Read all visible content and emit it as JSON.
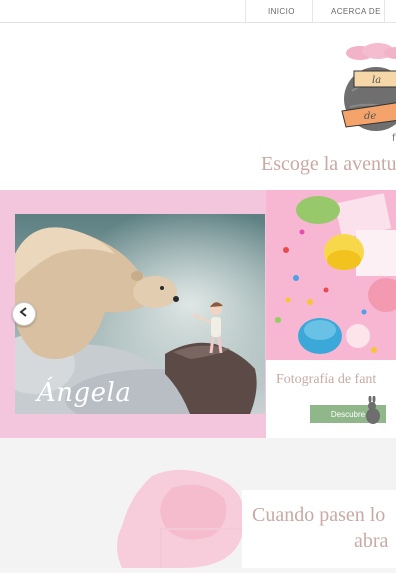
{
  "nav": {
    "items": [
      {
        "label": "INICIO"
      },
      {
        "label": "ACERCA DE"
      }
    ]
  },
  "header": {
    "headline": "Escoge la aventu"
  },
  "slider": {
    "caption": "Ángela",
    "prev_icon": "chevron-left-icon"
  },
  "card": {
    "title": "Fotografía de fant",
    "button_label": "Descubre"
  },
  "bottom": {
    "line1": "Cuando pasen lo",
    "line2": "abra"
  },
  "colors": {
    "band": "#f4c6dd",
    "accent_text": "#c9a9a4",
    "button": "#8fb78a"
  }
}
